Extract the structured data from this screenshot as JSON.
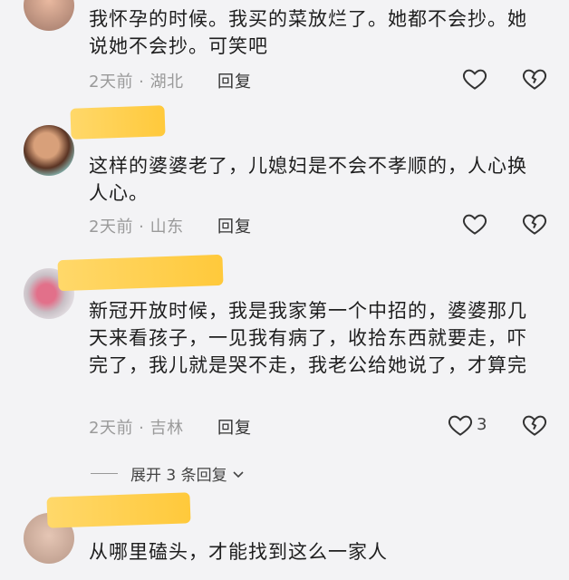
{
  "comments": [
    {
      "text": "我怀孕的时候。我买的菜放烂了。她都不会抄。她说她不会抄。可笑吧",
      "time": "2天前",
      "location": "湖北",
      "reply_label": "回复",
      "likes": ""
    },
    {
      "text": "这样的婆婆老了，儿媳妇是不会不孝顺的，人心换人心。",
      "time": "2天前",
      "location": "山东",
      "reply_label": "回复",
      "likes": ""
    },
    {
      "text": "新冠开放时候，我是我家第一个中招的，婆婆那几天来看孩子，一见我有病了，收拾东西就要走，吓完了，我儿就是哭不走，我老公给她说了，才算完",
      "time": "2天前",
      "location": "吉林",
      "reply_label": "回复",
      "likes": "3"
    },
    {
      "text": "从哪里磕头，才能找到这么一家人"
    }
  ],
  "meta_separator": " · ",
  "expand_label": "展开 3 条回复",
  "colors": {
    "background": "#f3f3f5",
    "name_redaction": "#ffcf4d",
    "meta": "#9a9a9a"
  },
  "icons": {
    "like": "heart-outline-icon",
    "dislike": "broken-heart-icon",
    "expand": "chevron-down-icon"
  }
}
